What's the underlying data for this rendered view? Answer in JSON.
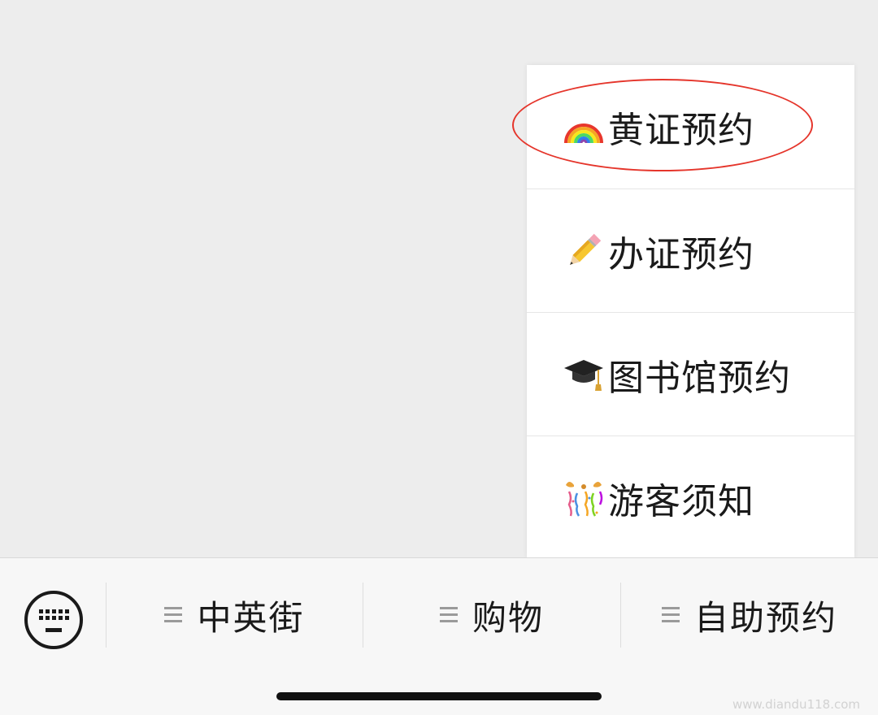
{
  "submenu": {
    "items": [
      {
        "icon": "rainbow-icon",
        "label": "黄证预约"
      },
      {
        "icon": "pencil-icon",
        "label": "办证预约"
      },
      {
        "icon": "graduation-cap-icon",
        "label": "图书馆预约"
      },
      {
        "icon": "party-popper-icon",
        "label": "游客须知"
      }
    ]
  },
  "bottom_bar": {
    "keyboard_icon": "keyboard-icon",
    "tabs": [
      {
        "label": "中英街"
      },
      {
        "label": "购物"
      },
      {
        "label": "自助预约"
      }
    ]
  },
  "watermark": "www.diandu118.com",
  "colors": {
    "highlight": "#e5352b",
    "background": "#ededed",
    "bar": "#f7f7f7"
  }
}
